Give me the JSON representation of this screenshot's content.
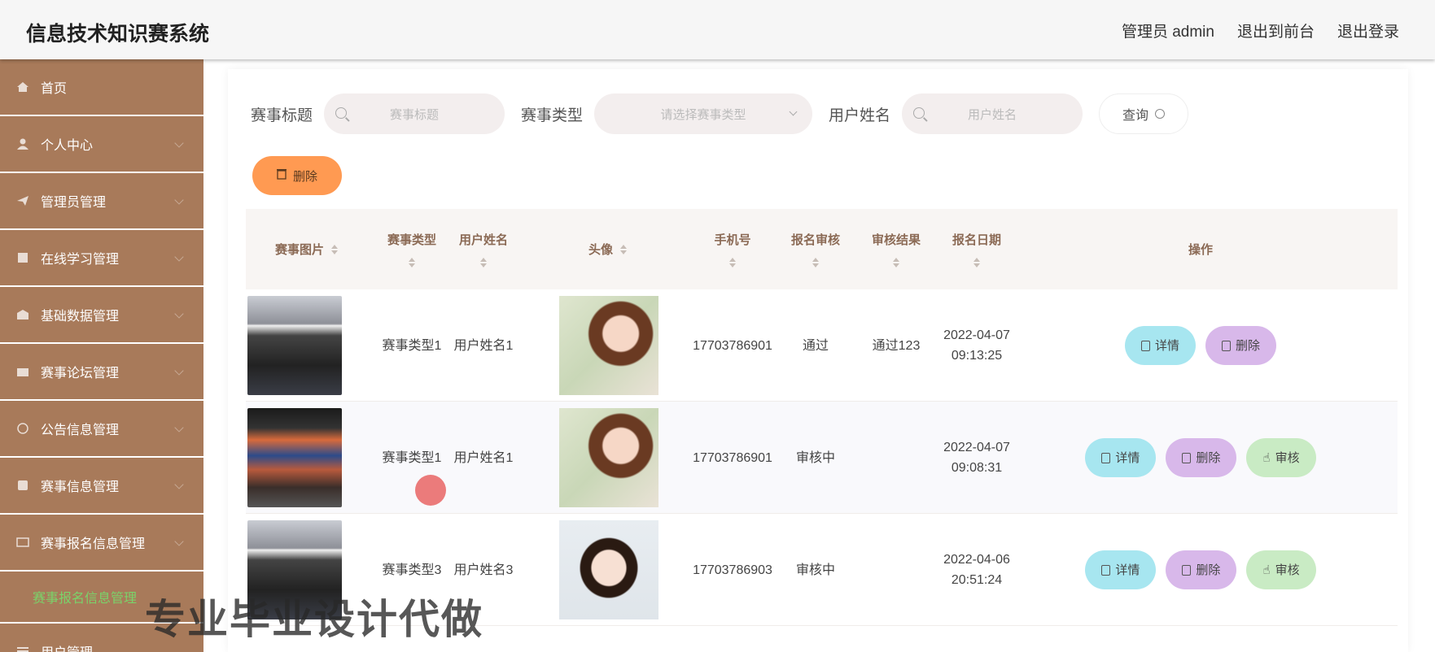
{
  "header": {
    "title": "信息技术知识赛系统",
    "admin_label": "管理员 admin",
    "exit_front": "退出到前台",
    "logout": "退出登录"
  },
  "sidebar": {
    "items": [
      {
        "label": "首页"
      },
      {
        "label": "个人中心"
      },
      {
        "label": "管理员管理"
      },
      {
        "label": "在线学习管理"
      },
      {
        "label": "基础数据管理"
      },
      {
        "label": "赛事论坛管理"
      },
      {
        "label": "公告信息管理"
      },
      {
        "label": "赛事信息管理"
      },
      {
        "label": "赛事报名信息管理"
      }
    ],
    "sub_item": "赛事报名信息管理",
    "last_item": "用户管理"
  },
  "search": {
    "title_label": "赛事标题",
    "title_placeholder": "赛事标题",
    "type_label": "赛事类型",
    "type_placeholder": "请选择赛事类型",
    "name_label": "用户姓名",
    "name_placeholder": "用户姓名",
    "query_label": "查询"
  },
  "actions": {
    "delete_label": "删除"
  },
  "table": {
    "headers": {
      "image": "赛事图片",
      "type": "赛事类型",
      "name": "用户姓名",
      "avatar": "头像",
      "phone": "手机号",
      "review": "报名审核",
      "result": "审核结果",
      "date": "报名日期",
      "ops": "操作"
    },
    "rows": [
      {
        "type": "赛事类型1",
        "name": "用户姓名1",
        "phone": "17703786901",
        "review": "通过",
        "result": "通过123",
        "date": "2022-04-07 09:13:25"
      },
      {
        "type": "赛事类型1",
        "name": "用户姓名1",
        "phone": "17703786901",
        "review": "审核中",
        "result": "",
        "date": "2022-04-07 09:08:31"
      },
      {
        "type": "赛事类型3",
        "name": "用户姓名3",
        "phone": "17703786903",
        "review": "审核中",
        "result": "",
        "date": "2022-04-06 20:51:24"
      }
    ],
    "op_detail": "详情",
    "op_delete": "删除",
    "op_review": "审核"
  },
  "watermark": "专业毕业设计代做"
}
